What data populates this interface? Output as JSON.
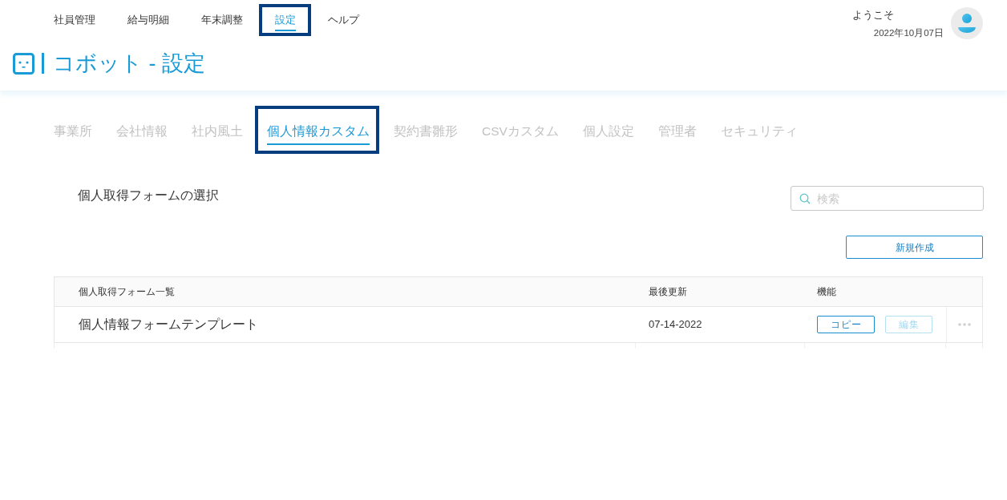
{
  "top_nav": {
    "items": [
      {
        "label": "社員管理",
        "selected": false,
        "highlighted": false
      },
      {
        "label": "給与明細",
        "selected": false,
        "highlighted": false
      },
      {
        "label": "年末調整",
        "selected": false,
        "highlighted": false
      },
      {
        "label": "設定",
        "selected": true,
        "highlighted": true
      },
      {
        "label": "ヘルプ",
        "selected": false,
        "highlighted": false
      }
    ]
  },
  "user": {
    "greeting": "ようこそ",
    "date": "2022年10月07日"
  },
  "page_title": "コボット - 設定",
  "settings_tabs": [
    {
      "label": "事業所",
      "selected": false,
      "highlighted": false
    },
    {
      "label": "会社情報",
      "selected": false,
      "highlighted": false
    },
    {
      "label": "社内風土",
      "selected": false,
      "highlighted": false
    },
    {
      "label": "個人情報カスタム",
      "selected": true,
      "highlighted": true
    },
    {
      "label": "契約書雛形",
      "selected": false,
      "highlighted": false
    },
    {
      "label": "CSVカスタム",
      "selected": false,
      "highlighted": false
    },
    {
      "label": "個人設定",
      "selected": false,
      "highlighted": false
    },
    {
      "label": "管理者",
      "selected": false,
      "highlighted": false
    },
    {
      "label": "セキュリティ",
      "selected": false,
      "highlighted": false
    }
  ],
  "section": {
    "title": "個人取得フォームの選択",
    "search": {
      "placeholder": "検索"
    },
    "new_button": "新規作成"
  },
  "table": {
    "columns": [
      "個人取得フォーム一覧",
      "最後更新",
      "機能"
    ],
    "rows": [
      {
        "name": "個人情報フォームテンプレート",
        "updated": "07-14-2022",
        "actions": [
          {
            "label": "コピー",
            "disabled": false
          },
          {
            "label": "編集",
            "disabled": true
          }
        ]
      }
    ]
  }
}
